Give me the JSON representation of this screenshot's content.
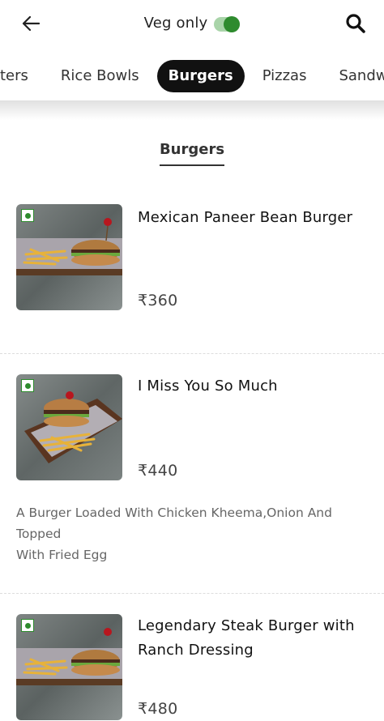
{
  "header": {
    "veg_only_label": "Veg only",
    "veg_only_on": true,
    "accent_color": "#2e8b2e"
  },
  "categories": [
    "ters",
    "Rice Bowls",
    "Burgers",
    "Pizzas",
    "Sandwic"
  ],
  "active_category": "Burgers",
  "section_title": "Burgers",
  "items": [
    {
      "name": "Mexican Paneer Bean Burger",
      "price": "₹360",
      "description": ""
    },
    {
      "name": "I Miss You So Much",
      "price": "₹440",
      "description_line1": "A Burger Loaded With Chicken Kheema,Onion And",
      "description_line2": "Topped",
      "description_line3": "With Fried Egg"
    },
    {
      "name_line1": "Legendary Steak Burger with",
      "name_line2": "Ranch Dressing",
      "price": "₹480"
    }
  ]
}
